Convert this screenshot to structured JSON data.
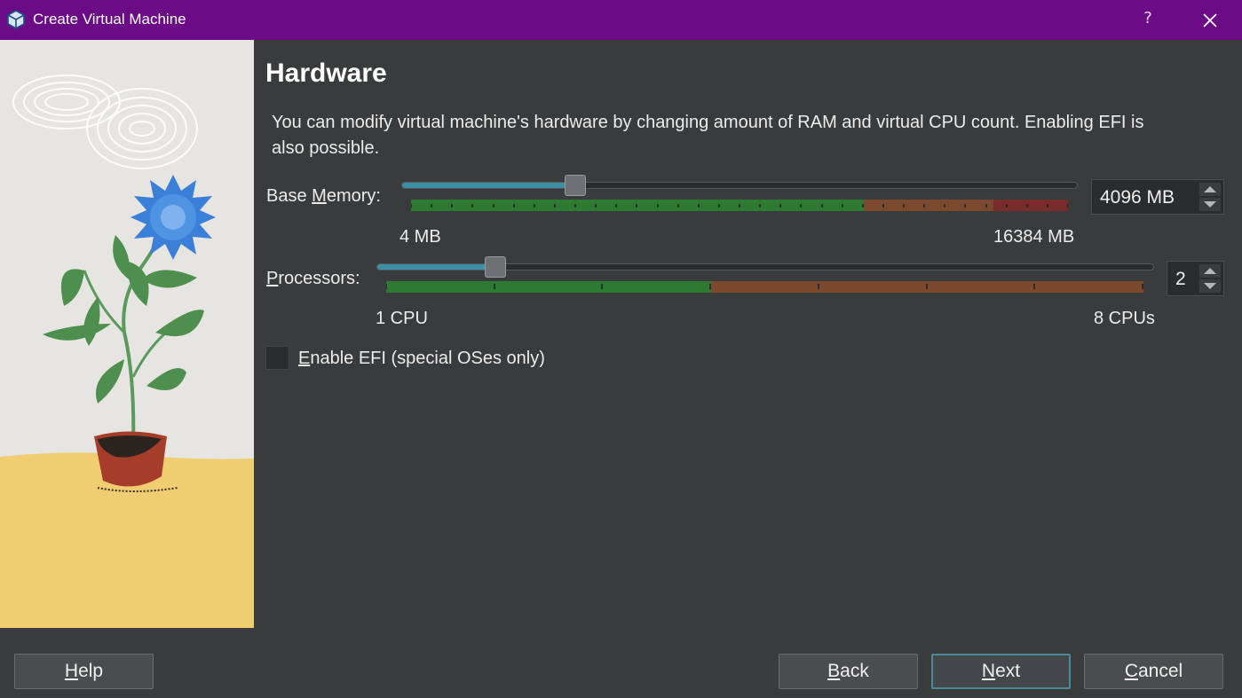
{
  "window": {
    "title": "Create Virtual Machine",
    "help_glyph": "?",
    "app_icon": "virtualbox-cube-icon",
    "close_icon": "close-icon"
  },
  "page": {
    "heading": "Hardware",
    "description": "You can modify virtual machine's hardware by changing amount of RAM and virtual CPU count. Enabling EFI is also possible."
  },
  "memory": {
    "label": "Base Memory:",
    "mnemonic": "M",
    "value": "4096 MB",
    "min_label": "4 MB",
    "max_label": "16384 MB",
    "value_mb": 4096,
    "min_mb": 4,
    "max_mb": 16384,
    "zones": {
      "green": "#2f7a33",
      "orange": "#7b4a2e",
      "red": "#7a2b2b"
    }
  },
  "processors": {
    "label": "Processors:",
    "mnemonic": "P",
    "value": "2",
    "min_label": "1 CPU",
    "max_label": "8 CPUs",
    "count": 2,
    "min": 1,
    "max": 8
  },
  "efi": {
    "label": "Enable EFI (special OSes only)",
    "mnemonic": "E",
    "checked": false
  },
  "buttons": {
    "help": "Help",
    "back": "Back",
    "next": "Next",
    "cancel": "Cancel"
  },
  "colors": {
    "titlebar": "#6b0b86",
    "background": "#3a3b3c",
    "slider_fill": "#3d8fa3",
    "default_button_border": "#4b8a99"
  }
}
